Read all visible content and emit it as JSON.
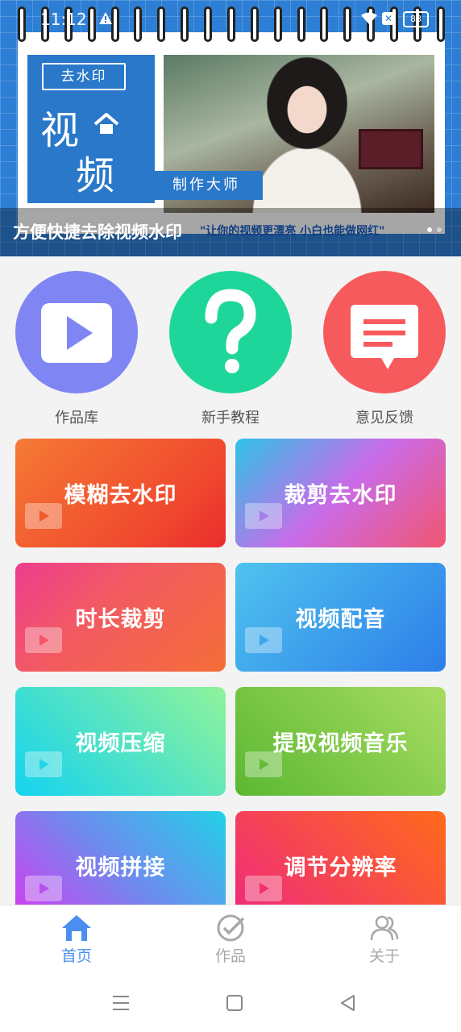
{
  "status_bar": {
    "time": "11:12",
    "battery": "88"
  },
  "banner": {
    "tag": "去水印",
    "logo_char_1": "视",
    "logo_char_2": "频",
    "subtitle": "制作大师",
    "caption_title": "方便快捷去除视频水印",
    "caption_quote": "\"让你的视频更漂亮 小白也能做网红\""
  },
  "quick_actions": [
    {
      "label": "作品库",
      "color": "#7f86f4",
      "icon": "play-icon"
    },
    {
      "label": "新手教程",
      "color": "#1ed69a",
      "icon": "question-icon"
    },
    {
      "label": "意见反馈",
      "color": "#f75a5c",
      "icon": "chat-icon"
    }
  ],
  "features": [
    {
      "label": "模糊去水印",
      "gradient": [
        "#f57a34",
        "#ea2d2d"
      ]
    },
    {
      "label": "裁剪去水印",
      "gradient": [
        "#2ec3e9",
        "#c96be8",
        "#f2566f"
      ]
    },
    {
      "label": "时长裁剪",
      "gradient": [
        "#ee3d8f",
        "#f56d38"
      ]
    },
    {
      "label": "视频配音",
      "gradient": [
        "#4fc3ef",
        "#2d7ee9"
      ]
    },
    {
      "label": "视频压缩",
      "gradient": [
        "#14d3f0",
        "#90f39a"
      ]
    },
    {
      "label": "提取视频音乐",
      "gradient": [
        "#5bb832",
        "#a8dc62"
      ]
    },
    {
      "label": "视频拼接",
      "gradient": [
        "#d43cf0",
        "#22d0e8"
      ]
    },
    {
      "label": "调节分辨率",
      "gradient": [
        "#ef2a7c",
        "#ff6a1a"
      ]
    }
  ],
  "bottom_nav": [
    {
      "label": "首页",
      "active": true
    },
    {
      "label": "作品",
      "active": false
    },
    {
      "label": "关于",
      "active": false
    }
  ],
  "colors": {
    "accent": "#4a8ff0",
    "inactive": "#a8a8a8"
  }
}
